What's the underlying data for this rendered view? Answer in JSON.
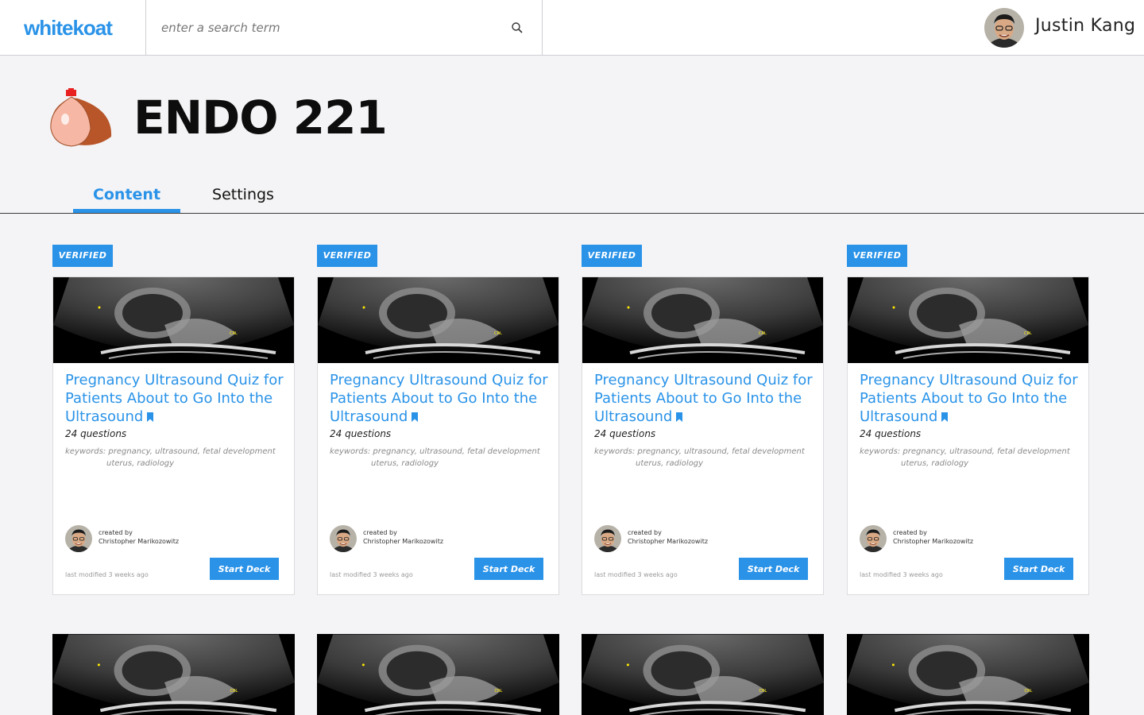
{
  "header": {
    "logo": "whitekoat",
    "search_placeholder": "enter a search term",
    "user_name": "Justin Kang"
  },
  "course": {
    "title": "ENDO 221",
    "icon": "ham-icon"
  },
  "tabs": [
    {
      "label": "Content",
      "active": true
    },
    {
      "label": "Settings",
      "active": false
    }
  ],
  "colors": {
    "accent": "#2a93e8"
  },
  "cards": [
    {
      "badge": "VERIFIED",
      "title": "Pregnancy Ultrasound Quiz for Patients About to Go Into the Ultrasound",
      "questions": "24 questions",
      "keywords_line1": "keywords: pregnancy, ultrasound, fetal development",
      "keywords_line2": "uterus, radiology",
      "created_label": "created by",
      "creator": "Christopher Marikozowitz",
      "modified": "last modified 3 weeks ago",
      "button": "Start Deck"
    },
    {
      "badge": "VERIFIED",
      "title": "Pregnancy Ultrasound Quiz for Patients About to Go Into the Ultrasound",
      "questions": "24 questions",
      "keywords_line1": "keywords: pregnancy, ultrasound, fetal development",
      "keywords_line2": "uterus, radiology",
      "created_label": "created by",
      "creator": "Christopher Marikozowitz",
      "modified": "last modified 3 weeks ago",
      "button": "Start Deck"
    },
    {
      "badge": "VERIFIED",
      "title": "Pregnancy Ultrasound Quiz for Patients About to Go Into the Ultrasound",
      "questions": "24 questions",
      "keywords_line1": "keywords: pregnancy, ultrasound, fetal development",
      "keywords_line2": "uterus, radiology",
      "created_label": "created by",
      "creator": "Christopher Marikozowitz",
      "modified": "last modified 3 weeks ago",
      "button": "Start Deck"
    },
    {
      "badge": "VERIFIED",
      "title": "Pregnancy Ultrasound Quiz for Patients About to Go Into the Ultrasound",
      "questions": "24 questions",
      "keywords_line1": "keywords: pregnancy, ultrasound, fetal development",
      "keywords_line2": "uterus, radiology",
      "created_label": "created by",
      "creator": "Christopher Marikozowitz",
      "modified": "last modified 3 weeks ago",
      "button": "Start Deck"
    }
  ]
}
